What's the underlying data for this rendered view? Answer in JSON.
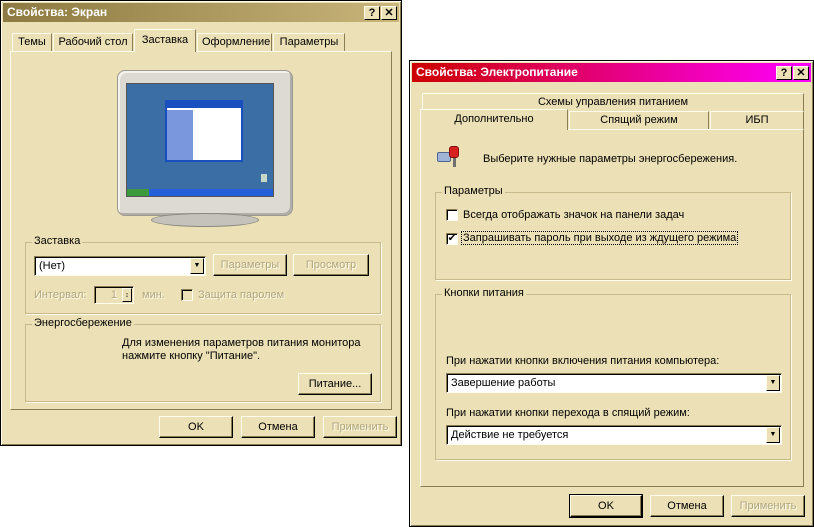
{
  "display_dialog": {
    "title": "Свойства: Экран",
    "help_btn": "?",
    "close_btn": "✕",
    "tabs": [
      "Темы",
      "Рабочий стол",
      "Заставка",
      "Оформление",
      "Параметры"
    ],
    "screensaver": {
      "group_label": "Заставка",
      "selected": "(Нет)",
      "settings_btn": "Параметры",
      "preview_btn": "Просмотр",
      "interval_label": "Интервал:",
      "interval_value": "1",
      "min_label": "мин.",
      "password_label": "Защита паролем"
    },
    "power": {
      "group_label": "Энергосбережение",
      "description": "Для изменения параметров питания монитора нажмите кнопку \"Питание\".",
      "power_btn": "Питание..."
    },
    "buttons": {
      "ok": "OK",
      "cancel": "Отмена",
      "apply": "Применить"
    }
  },
  "power_dialog": {
    "title": "Свойства: Электропитание",
    "help_btn": "?",
    "close_btn": "✕",
    "tabs_top": [
      "Схемы управления питанием"
    ],
    "tabs_bottom": [
      "Дополнительно",
      "Спящий режим",
      "ИБП"
    ],
    "intro": "Выберите нужные параметры энергосбережения.",
    "params": {
      "group_label": "Параметры",
      "show_icon": {
        "label": "Всегда отображать значок на панели задач",
        "checked": false
      },
      "ask_password": {
        "label": "Запрашивать пароль при выходе из ждущего режима",
        "checked": true
      }
    },
    "power_buttons": {
      "group_label": "Кнопки питания",
      "power_label": "При нажатии кнопки включения питания компьютера:",
      "power_value": "Завершение работы",
      "sleep_label": "При нажатии кнопки перехода в спящий режим:",
      "sleep_value": "Действие не требуется"
    },
    "buttons": {
      "ok": "OK",
      "cancel": "Отмена",
      "apply": "Применить"
    }
  },
  "colors": {
    "display_title_bg": "#8c7a42",
    "power_title_bg_from": "#cc0000",
    "power_title_bg_to": "#ff00ff",
    "dialog_bg": "#ece1b6"
  }
}
